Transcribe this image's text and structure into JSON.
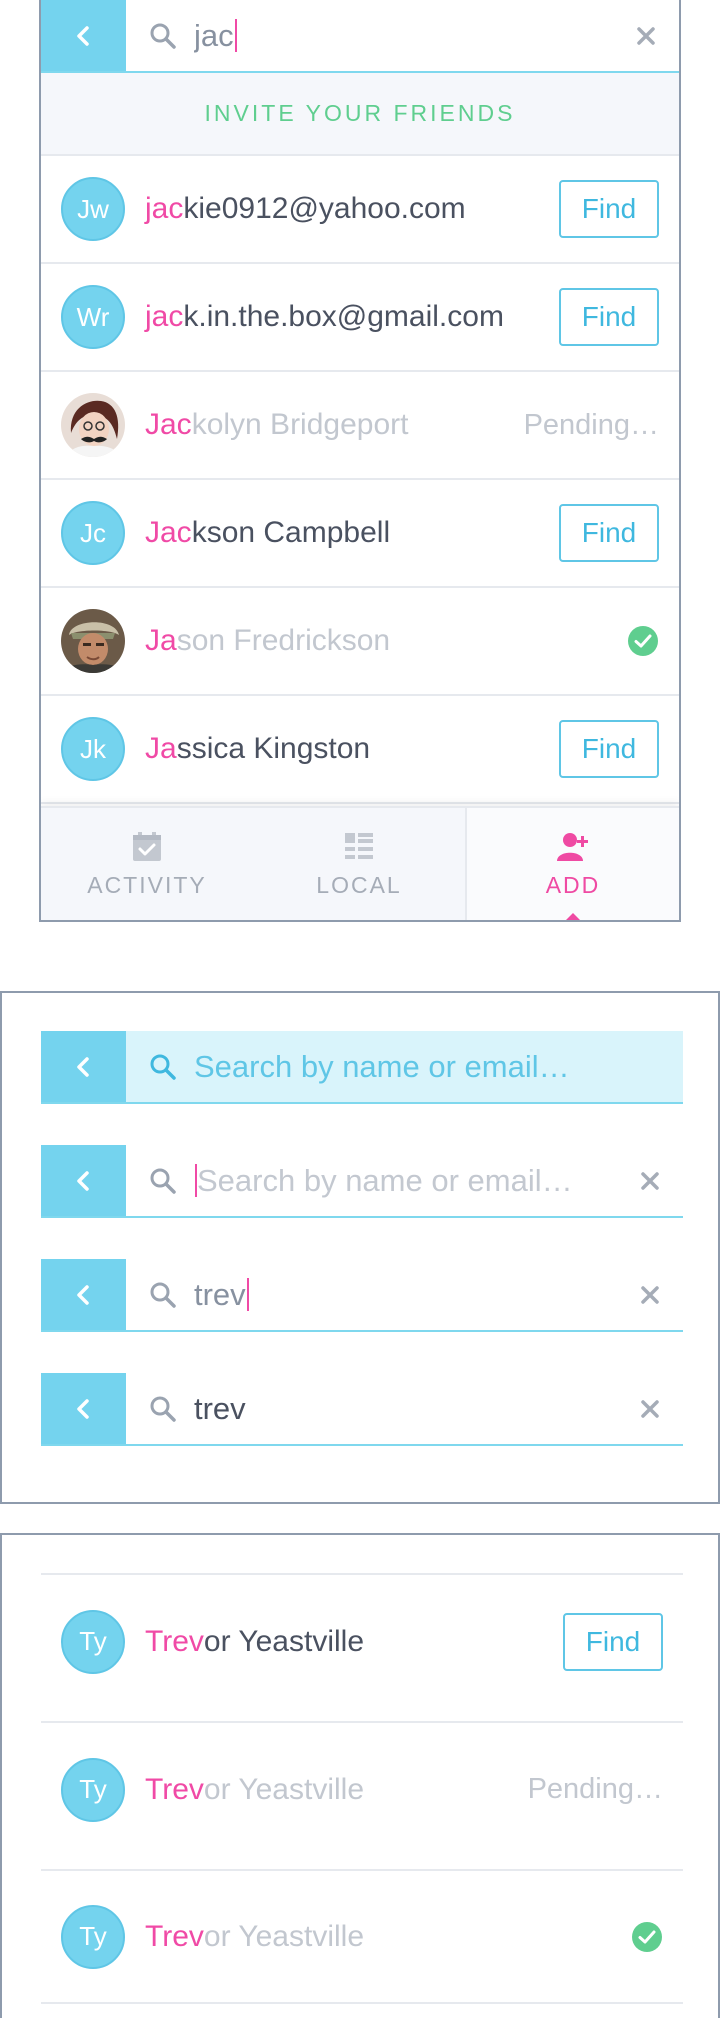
{
  "panel1": {
    "search": {
      "query": "jac"
    },
    "invite_label": "INVITE YOUR FRIENDS",
    "results": [
      {
        "initials": "Jw",
        "match": "jac",
        "rest": "kie0912@yahoo.com",
        "state": "find",
        "button_label": "Find"
      },
      {
        "initials": "Wr",
        "match": "jac",
        "rest": "k.in.the.box@gmail.com",
        "state": "find",
        "button_label": "Find"
      },
      {
        "initials": "",
        "match": "Jac",
        "rest": "kolyn Bridgeport",
        "state": "pending",
        "status_label": "Pending…"
      },
      {
        "initials": "Jc",
        "match": "Jac",
        "rest": "kson Campbell",
        "state": "find",
        "button_label": "Find"
      },
      {
        "initials": "",
        "match": "Ja",
        "rest": "son Fredrickson",
        "state": "added"
      },
      {
        "initials": "Jk",
        "match": "Ja",
        "rest": "ssica Kingston",
        "state": "find",
        "button_label": "Find"
      }
    ],
    "tabs": [
      {
        "label": "ACTIVITY",
        "icon": "calendar-check-icon"
      },
      {
        "label": "LOCAL",
        "icon": "list-grid-icon"
      },
      {
        "label": "ADD",
        "icon": "add-user-icon",
        "active": true
      }
    ]
  },
  "panel2": {
    "states": [
      {
        "placeholder": "Search by name or email…"
      },
      {
        "placeholder": "Search by name or email…"
      },
      {
        "value": "trev"
      },
      {
        "value": "trev"
      }
    ]
  },
  "panel3": {
    "results": [
      {
        "initials": "Ty",
        "match": "Trev",
        "rest": "or Yeastville",
        "button_label": "Find"
      },
      {
        "initials": "Ty",
        "match": "Trev",
        "rest": "or Yeastville",
        "status_label": "Pending…"
      },
      {
        "initials": "Ty",
        "match": "Trev",
        "rest": "or Yeastville"
      }
    ]
  },
  "colors": {
    "accent_blue": "#74d3ee",
    "highlight_pink": "#f04aa6",
    "success_green": "#5fce8f"
  }
}
